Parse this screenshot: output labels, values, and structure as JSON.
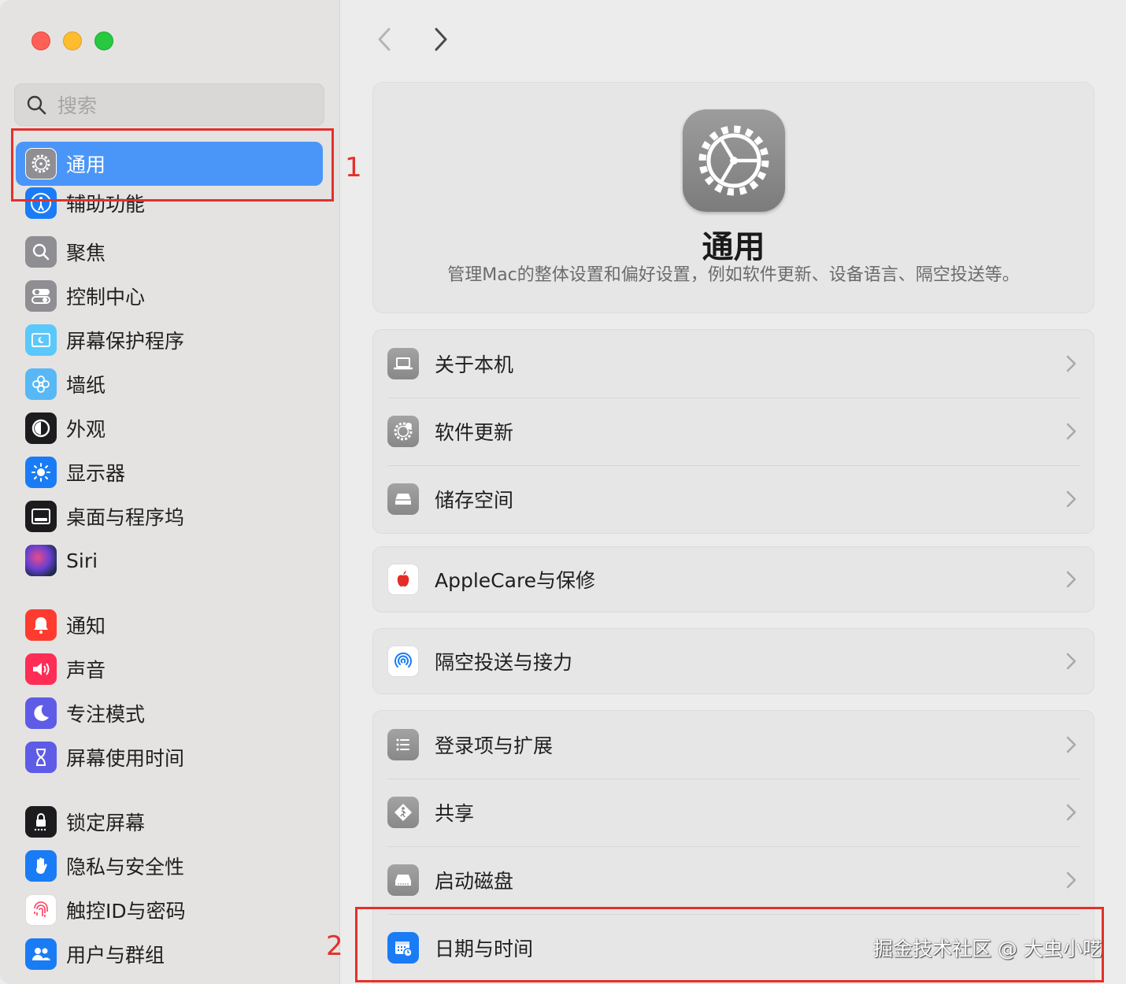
{
  "search": {
    "placeholder": "搜索"
  },
  "sidebar": {
    "items": [
      {
        "label": "通用",
        "icon": "gear-icon",
        "color": "#8e8e93",
        "selected": true
      },
      {
        "label": "辅助功能",
        "icon": "accessibility-icon",
        "color": "#1a7cf5"
      },
      {
        "label": "聚焦",
        "icon": "spotlight-icon",
        "color": "#8e8e93"
      },
      {
        "label": "控制中心",
        "icon": "control-center-icon",
        "color": "#8e8e93"
      },
      {
        "label": "屏幕保护程序",
        "icon": "screensaver-icon",
        "color": "#5ac8fa"
      },
      {
        "label": "墙纸",
        "icon": "wallpaper-icon",
        "color": "#58b8f5"
      },
      {
        "label": "外观",
        "icon": "appearance-icon",
        "color": "#1c1c1e"
      },
      {
        "label": "显示器",
        "icon": "display-icon",
        "color": "#1a7cf5"
      },
      {
        "label": "桌面与程序坞",
        "icon": "dock-icon",
        "color": "#1c1c1e"
      },
      {
        "label": "Siri",
        "icon": "siri-icon",
        "color": "#2d2d4e"
      },
      {
        "label": "通知",
        "icon": "notification-icon",
        "color": "#ff3b30"
      },
      {
        "label": "声音",
        "icon": "sound-icon",
        "color": "#ff2d55"
      },
      {
        "label": "专注模式",
        "icon": "moon-icon",
        "color": "#5e5ce6"
      },
      {
        "label": "屏幕使用时间",
        "icon": "hourglass-icon",
        "color": "#5e5ce6"
      },
      {
        "label": "锁定屏幕",
        "icon": "lock-icon",
        "color": "#1c1c1e"
      },
      {
        "label": "隐私与安全性",
        "icon": "hand-icon",
        "color": "#1a7cf5"
      },
      {
        "label": "触控ID与密码",
        "icon": "fingerprint-icon",
        "color": "#ffffff"
      },
      {
        "label": "用户与群组",
        "icon": "users-icon",
        "color": "#1a7cf5"
      }
    ]
  },
  "main": {
    "title": "通用",
    "description": "管理Mac的整体设置和偏好设置，例如软件更新、设备语言、隔空投送等。",
    "groups": [
      {
        "rows": [
          {
            "label": "关于本机",
            "icon": "laptop-icon"
          },
          {
            "label": "软件更新",
            "icon": "gear-update-icon"
          },
          {
            "label": "储存空间",
            "icon": "storage-icon"
          }
        ]
      },
      {
        "rows": [
          {
            "label": "AppleCare与保修",
            "icon": "apple-icon"
          }
        ]
      },
      {
        "rows": [
          {
            "label": "隔空投送与接力",
            "icon": "airdrop-icon"
          }
        ]
      },
      {
        "rows": [
          {
            "label": "登录项与扩展",
            "icon": "list-icon"
          },
          {
            "label": "共享",
            "icon": "sharing-icon"
          },
          {
            "label": "启动磁盘",
            "icon": "disk-icon"
          },
          {
            "label": "日期与时间",
            "icon": "calendar-clock-icon"
          }
        ]
      }
    ]
  },
  "annotations": {
    "marker1": "1",
    "marker2": "2",
    "accent": "#e4302a"
  },
  "watermark": "掘金技术社区 @ 大虫小呓"
}
